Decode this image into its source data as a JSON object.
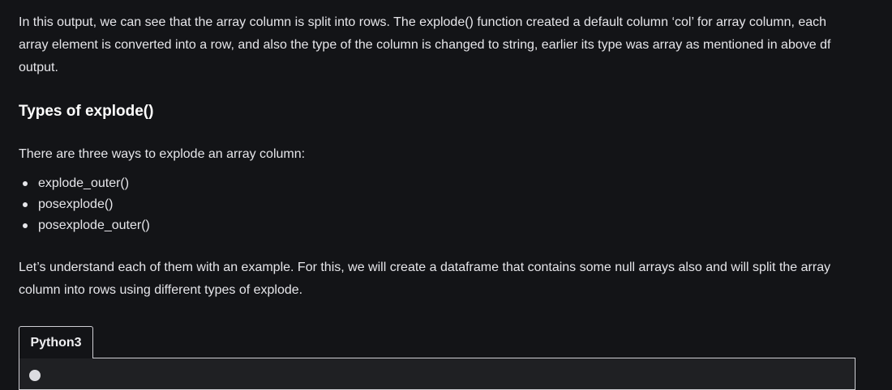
{
  "article": {
    "intro_paragraph": "In this output, we can see that the array column is split into rows. The explode() function created a default column ‘col’ for array column, each array element is converted into a row, and also the type of the column is changed to string, earlier its type was array as mentioned in above df output.",
    "section_heading": "Types of explode()",
    "ways_intro": "There are three ways to explode an array column:",
    "ways": [
      "explode_outer()",
      "posexplode()",
      "posexplode_outer()"
    ],
    "example_paragraph": "Let’s understand each of them with an example. For this, we will create a dataframe that contains some null arrays also and will split the array column into rows using different types of explode."
  },
  "code_block": {
    "tab_label": "Python3",
    "corner_icon": "copy-icon"
  },
  "colors": {
    "background": "#131417",
    "text": "#e6e6ea",
    "heading": "#ffffff",
    "code_border": "#cfcfd4",
    "code_background": "#1f2023"
  }
}
